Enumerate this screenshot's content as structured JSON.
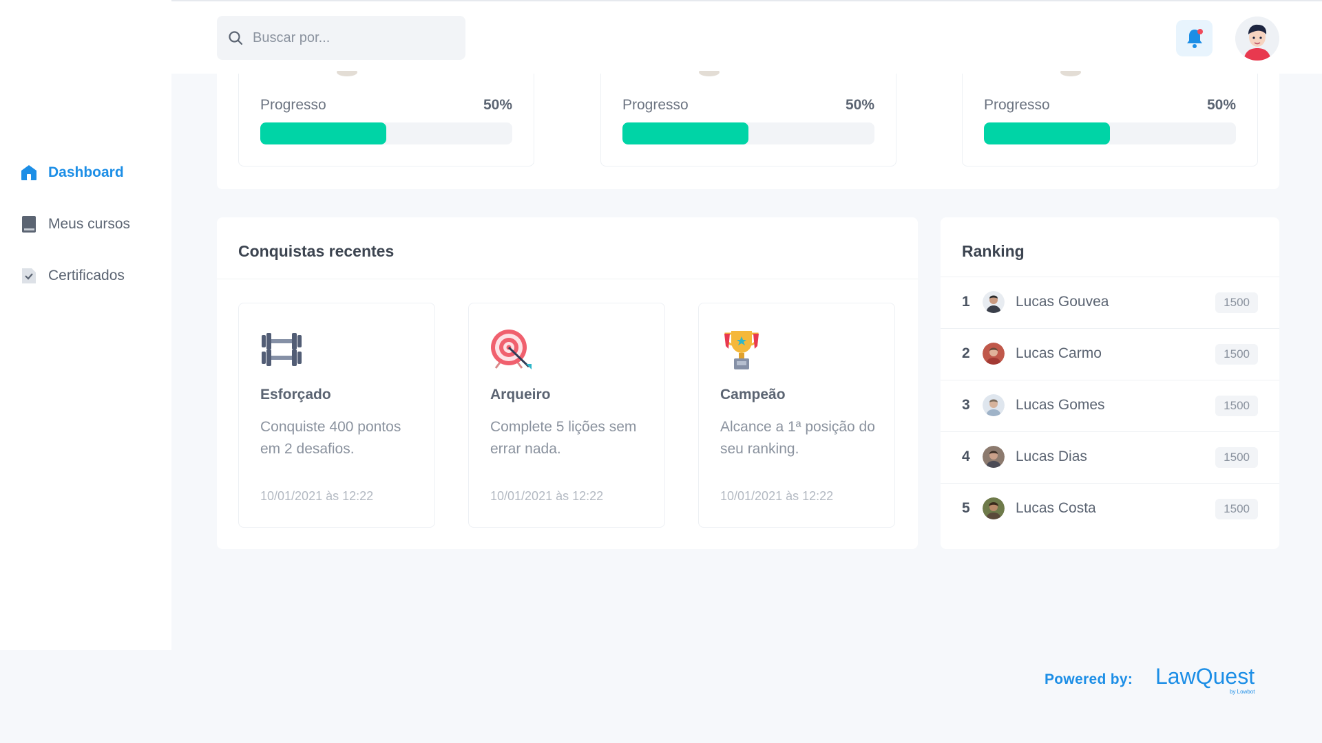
{
  "sidebar": {
    "items": [
      {
        "label": "Dashboard",
        "icon": "home-icon",
        "active": true
      },
      {
        "label": "Meus cursos",
        "icon": "book-icon",
        "active": false
      },
      {
        "label": "Certificados",
        "icon": "certificate-icon",
        "active": false
      }
    ]
  },
  "header": {
    "search_placeholder": "Buscar por...",
    "notification_dot": true
  },
  "courses": [
    {
      "progress_label": "Progresso",
      "progress_value": "50%",
      "progress_fraction": 0.5
    },
    {
      "progress_label": "Progresso",
      "progress_value": "50%",
      "progress_fraction": 0.5
    },
    {
      "progress_label": "Progresso",
      "progress_value": "50%",
      "progress_fraction": 0.5
    }
  ],
  "achievements": {
    "title": "Conquistas recentes",
    "items": [
      {
        "icon": "dumbbell-icon",
        "name": "Esforçado",
        "desc": "Conquiste 400 pontos em 2 desafios.",
        "date": "10/01/2021 às 12:22"
      },
      {
        "icon": "target-icon",
        "name": "Arqueiro",
        "desc": "Complete 5 lições sem errar nada.",
        "date": "10/01/2021 às 12:22"
      },
      {
        "icon": "trophy-icon",
        "name": "Campeão",
        "desc": "Alcance a 1ª posição do seu ranking.",
        "date": "10/01/2021 às 12:22"
      }
    ]
  },
  "ranking": {
    "title": "Ranking",
    "rows": [
      {
        "pos": "1",
        "name": "Lucas Gouvea",
        "score": "1500"
      },
      {
        "pos": "2",
        "name": "Lucas Carmo",
        "score": "1500"
      },
      {
        "pos": "3",
        "name": "Lucas Gomes",
        "score": "1500"
      },
      {
        "pos": "4",
        "name": "Lucas Dias",
        "score": "1500"
      },
      {
        "pos": "5",
        "name": "Lucas Costa",
        "score": "1500"
      }
    ]
  },
  "footer": {
    "powered_by": "Powered by:",
    "brand": "LawQuest",
    "brand_sub": "by Lowbot"
  },
  "colors": {
    "accent": "#1c8ee6",
    "progress": "#00d4a6",
    "background": "#f6f8fb"
  }
}
